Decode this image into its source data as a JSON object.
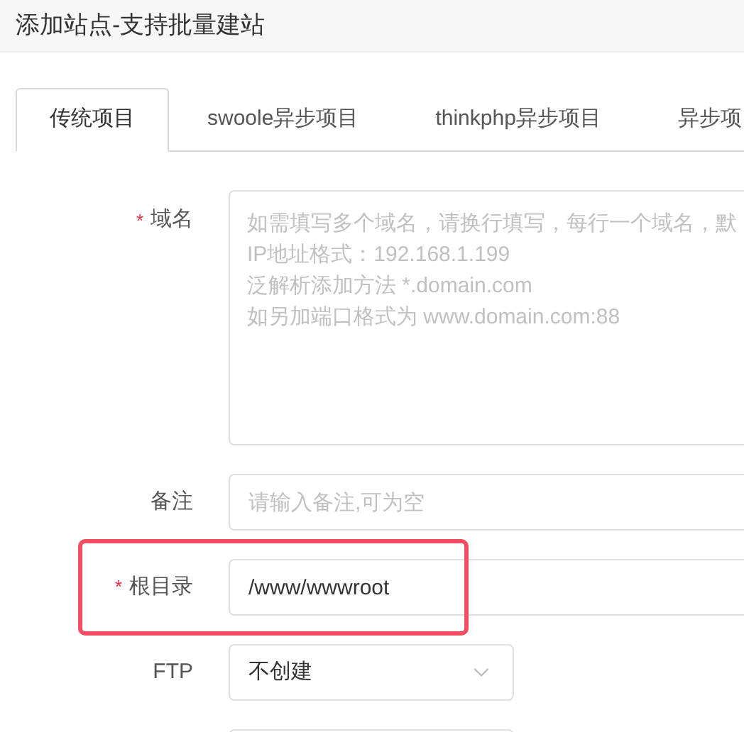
{
  "window": {
    "title": "添加站点-支持批量建站"
  },
  "tabs": [
    {
      "label": "传统项目",
      "selected": true
    },
    {
      "label": "swoole异步项目",
      "selected": false
    },
    {
      "label": "thinkphp异步项目",
      "selected": false
    },
    {
      "label": "异步项",
      "selected": false
    }
  ],
  "form": [
    {
      "kind": "textarea",
      "label": "域名",
      "required_mark": "*",
      "highlighted": false,
      "placeholder_lines": [
        "如需填写多个域名，请换行填写，每行一个域名，默",
        "IP地址格式：192.168.1.199",
        "泛解析添加方法 *.domain.com",
        "如另加端口格式为 www.domain.com:88"
      ]
    },
    {
      "kind": "input",
      "label": "备注",
      "highlighted": false,
      "placeholder": "请输入备注,可为空"
    },
    {
      "kind": "input",
      "label": "根目录",
      "required_mark": "*",
      "highlighted": true,
      "value": "/www/wwwroot"
    },
    {
      "kind": "select",
      "label": "FTP",
      "highlighted": false,
      "value": "不创建"
    },
    {
      "kind": "select_partial",
      "highlighted": false
    }
  ]
}
